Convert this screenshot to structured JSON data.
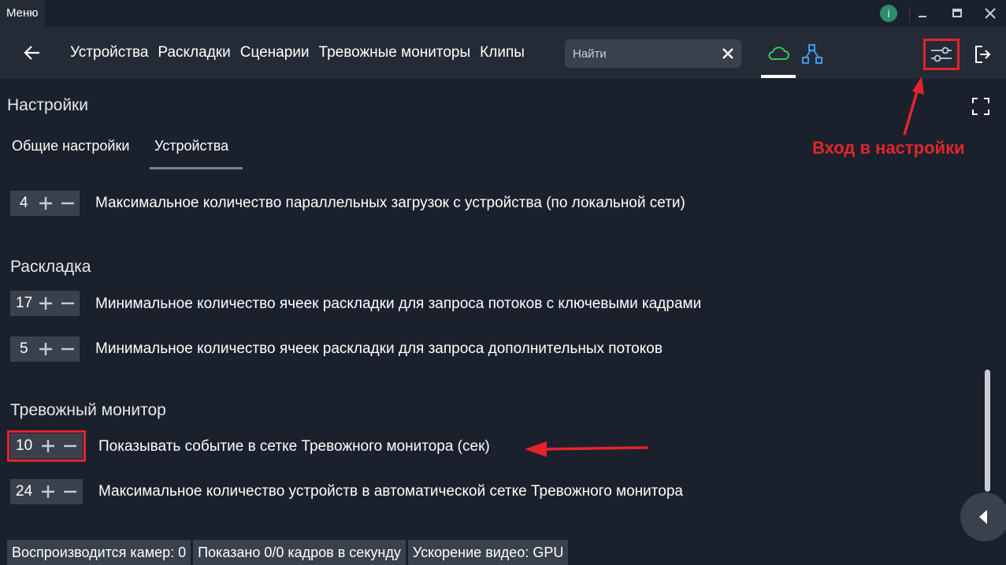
{
  "titlebar": {
    "menu_label": "Меню",
    "info_icon": "i"
  },
  "nav": {
    "links": [
      "Устройства",
      "Раскладки",
      "Сценарии",
      "Тревожные мониторы",
      "Клипы"
    ],
    "search_placeholder": "Найти"
  },
  "page": {
    "title": "Настройки",
    "tabs": [
      "Общие настройки",
      "Устройства"
    ],
    "active_tab": "Устройства",
    "annotation": "Вход в настройки"
  },
  "settings": {
    "devices_row": {
      "value": "4",
      "label": "Максимальное количество параллельных загрузок с устройства (по локальной сети)"
    },
    "layout_section": "Раскладка",
    "layout_rows": [
      {
        "value": "17",
        "label": "Минимальное количество ячеек раскладки для запроса потоков с ключевыми кадрами"
      },
      {
        "value": "5",
        "label": "Минимальное количество ячеек раскладки для запроса дополнительных потоков"
      }
    ],
    "alarm_section": "Тревожный монитор",
    "alarm_rows": [
      {
        "value": "10",
        "label": "Показывать событие в сетке Тревожного монитора (сек)"
      },
      {
        "value": "24",
        "label": "Максимальное количество устройств в автоматической сетке Тревожного монитора"
      }
    ]
  },
  "status": [
    "Воспроизводится камер: 0",
    "Показано 0/0 кадров в секунду",
    "Ускорение видео: GPU"
  ],
  "colors": {
    "accent_red": "#e2242c",
    "cloud_green": "#35c759",
    "network_blue": "#3d9be9"
  }
}
